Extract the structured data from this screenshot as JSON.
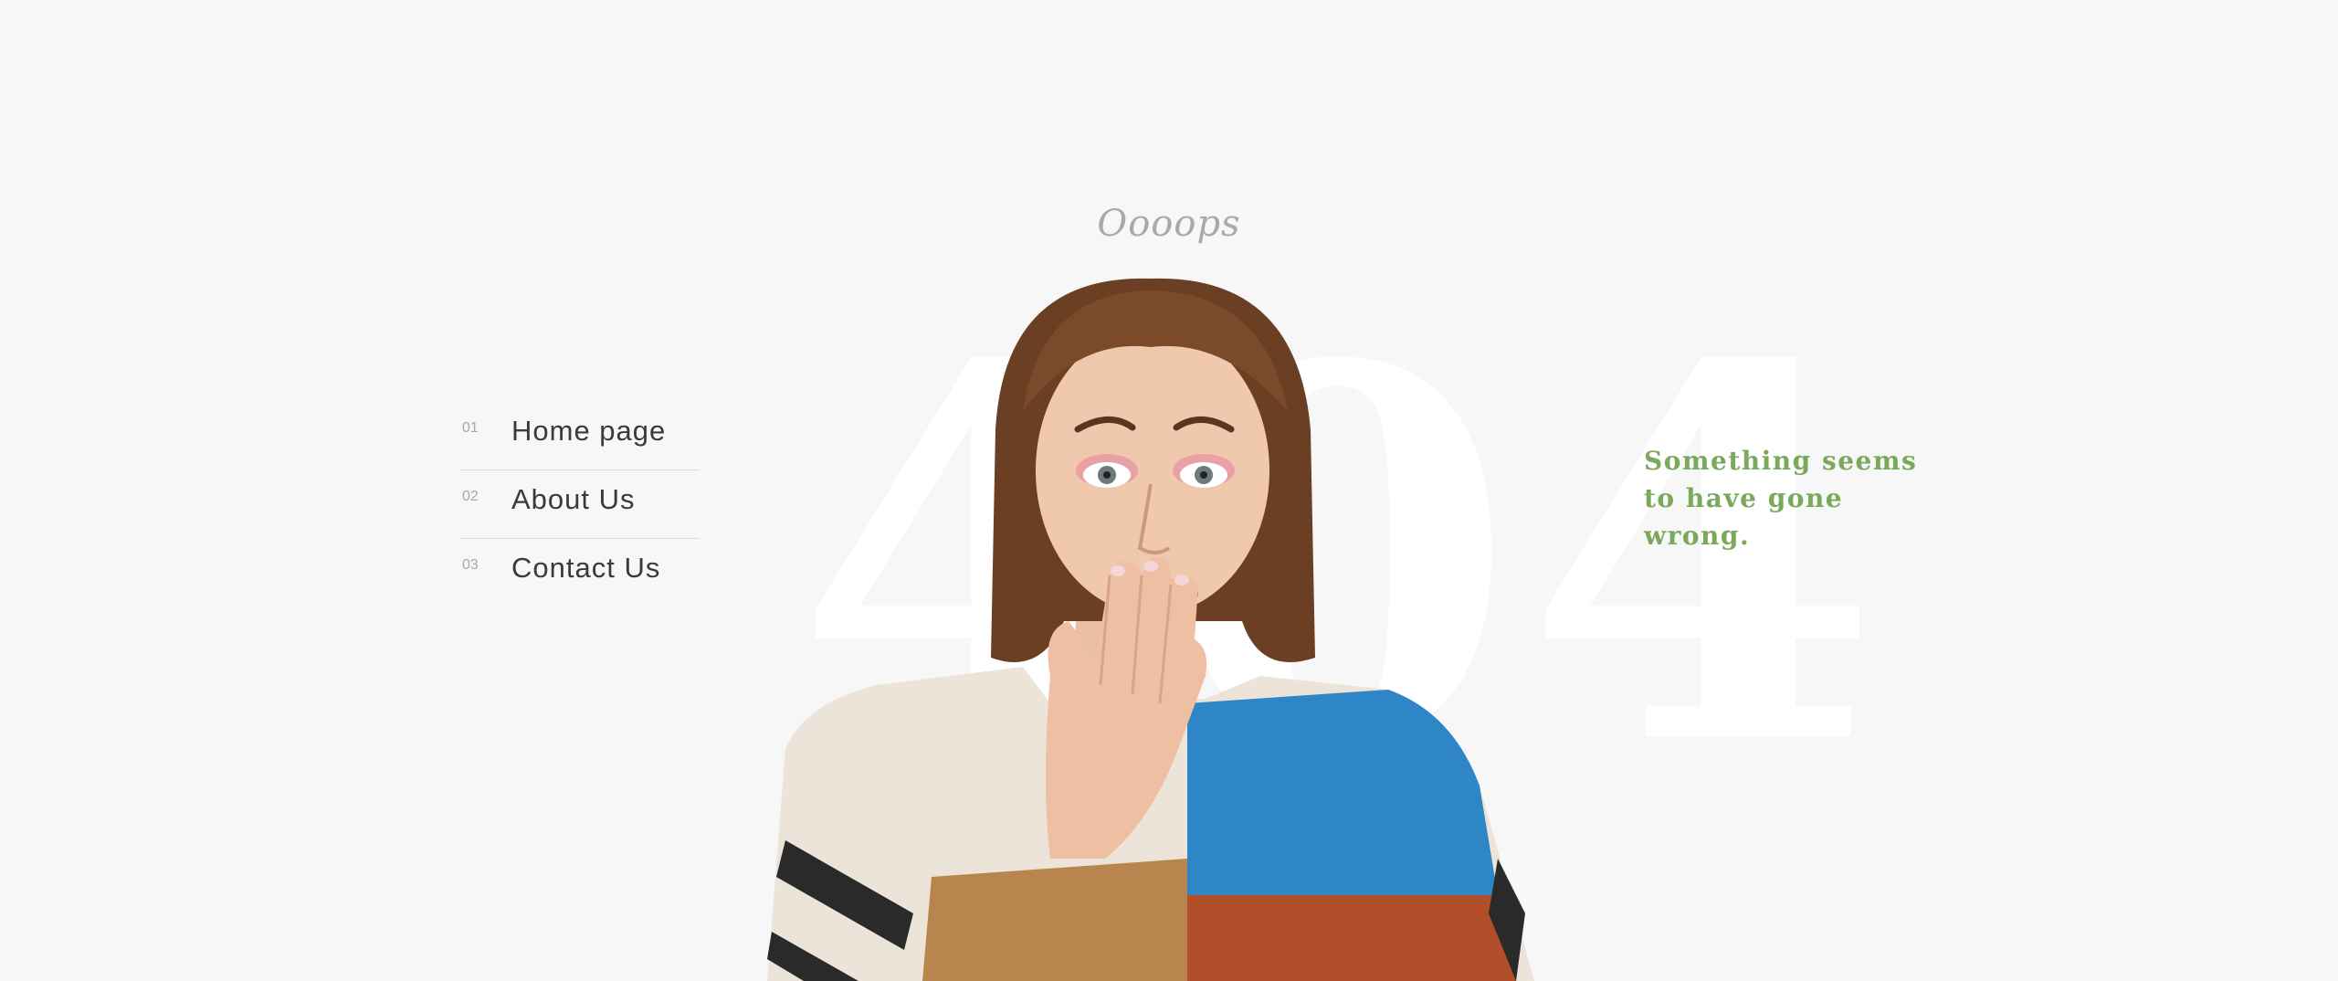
{
  "header": {
    "script_title": "Oooops"
  },
  "hero": {
    "big_digits": [
      "4",
      "0",
      "4"
    ],
    "message": "Something seems to have gone wrong."
  },
  "nav": {
    "items": [
      {
        "number": "01",
        "label": "Home page"
      },
      {
        "number": "02",
        "label": "About Us"
      },
      {
        "number": "03",
        "label": "Contact Us"
      }
    ]
  },
  "colors": {
    "background": "#f7f7f7",
    "accent_green": "#7aa95c",
    "nav_text": "#3a3a3a",
    "muted": "#a8a8a8"
  }
}
